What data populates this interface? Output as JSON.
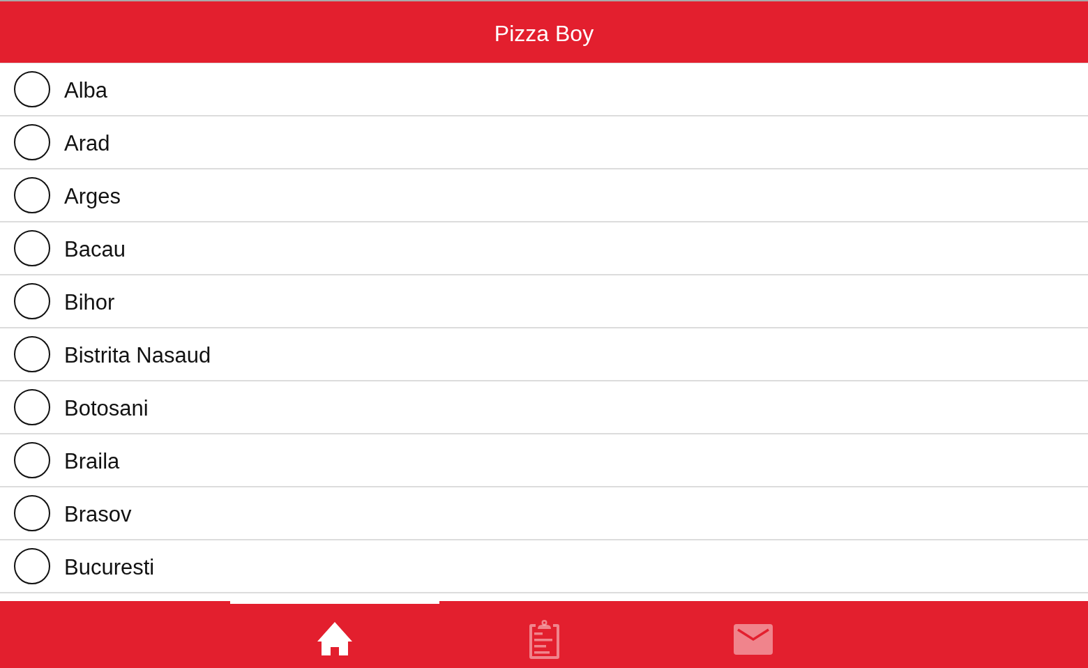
{
  "header": {
    "title": "Pizza Boy"
  },
  "provinces": [
    {
      "name": "Alba",
      "selected": false
    },
    {
      "name": "Arad",
      "selected": false
    },
    {
      "name": "Arges",
      "selected": false
    },
    {
      "name": "Bacau",
      "selected": false
    },
    {
      "name": "Bihor",
      "selected": false
    },
    {
      "name": "Bistrita Nasaud",
      "selected": false
    },
    {
      "name": "Botosani",
      "selected": false
    },
    {
      "name": "Braila",
      "selected": false
    },
    {
      "name": "Brasov",
      "selected": false
    },
    {
      "name": "Bucuresti",
      "selected": false
    }
  ],
  "tabs": [
    {
      "kind": "home",
      "selected": true
    },
    {
      "kind": "clipboard",
      "selected": false
    },
    {
      "kind": "mail",
      "selected": false
    }
  ]
}
